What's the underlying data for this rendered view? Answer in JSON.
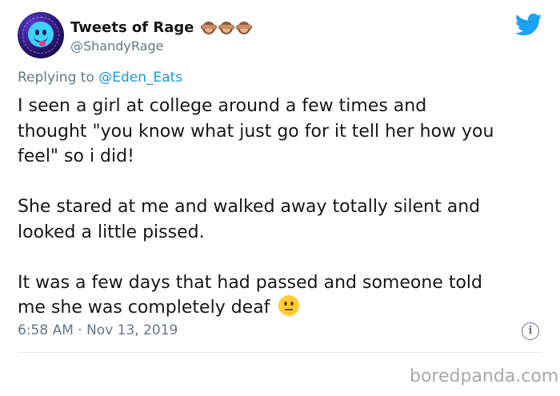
{
  "header": {
    "display_name": "Tweets of Rage",
    "handle": "@ShandyRage",
    "name_emojis": [
      "see-no-evil-monkey-icon",
      "see-no-evil-monkey-icon",
      "see-no-evil-monkey-icon"
    ],
    "brand_icon": "twitter-bird-icon"
  },
  "reply": {
    "prefix": "Replying to ",
    "mention": "@Eden_Eats"
  },
  "body": {
    "paragraph1_lines": [
      "I seen a girl at college around a few times and",
      "thought \"you know what just go for it tell her how you",
      "feel\" so i did!"
    ],
    "paragraph2_lines": [
      "She stared at me and walked away totally silent and",
      "looked a little pissed."
    ],
    "paragraph3_lines": [
      "It was a few days that had passed and someone told",
      "me she was completely deaf"
    ],
    "trailing_emoji": "neutral-face-emoji"
  },
  "footer": {
    "timestamp": "6:58 AM · Nov 13, 2019",
    "info_icon": "info-icon",
    "info_glyph": "i"
  },
  "watermark": "boredpanda.com",
  "colors": {
    "text": "#14171a",
    "secondary": "#657786",
    "link": "#1b95e0",
    "twitter_blue": "#1da1f2",
    "divider": "#e1e8ed",
    "watermark": "#a9a9a9"
  }
}
